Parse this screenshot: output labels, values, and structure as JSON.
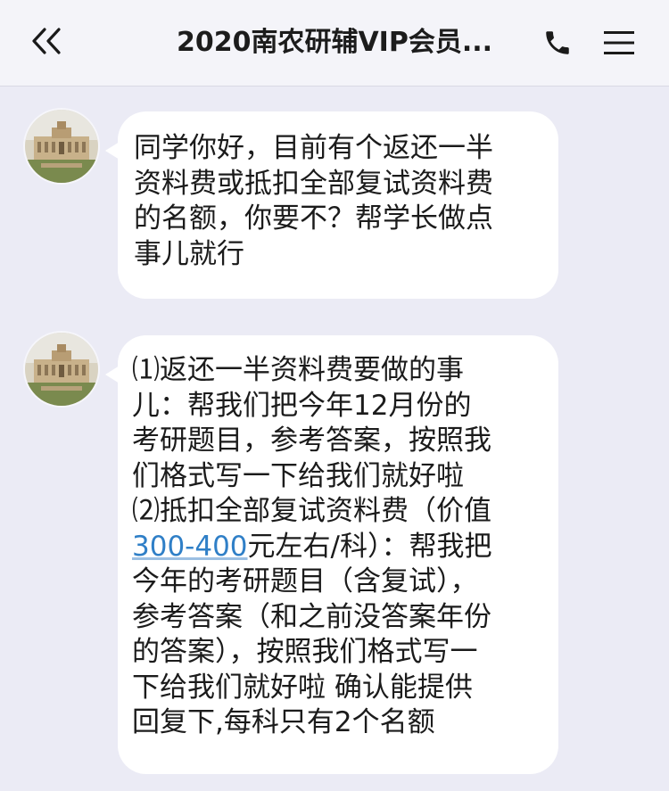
{
  "header": {
    "title": "2020南农研辅VIP会员...",
    "back_icon": "double-chevron-left-icon",
    "phone_icon": "phone-icon",
    "menu_icon": "hamburger-menu-icon"
  },
  "messages": [
    {
      "avatar_icon": "campus-building-avatar",
      "lines": [
        "同学你好，目前有个返还一半",
        "资料费或抵扣全部复试资料费",
        "的名额，你要不？帮学长做点",
        "事儿就行"
      ]
    },
    {
      "avatar_icon": "campus-building-avatar",
      "lines": [
        "⑴返还一半资料费要做的事",
        "儿：帮我们把今年12月份的",
        "考研题目，参考答案，按照我",
        "们格式写一下给我们就好啦",
        "⑵抵扣全部复试资料费（价值",
        "元左右/科）：帮我把",
        "今年的考研题目（含复试），",
        "参考答案（和之前没答案年份",
        "的答案），按照我们格式写一",
        "下给我们就好啦 确认能提供",
        "回复下,每科只有2个名额"
      ],
      "link_text": "300-400"
    }
  ],
  "colors": {
    "background": "#ebebf5",
    "header": "#f4f4f9",
    "bubble": "#ffffff",
    "link": "#2f7fc7"
  }
}
